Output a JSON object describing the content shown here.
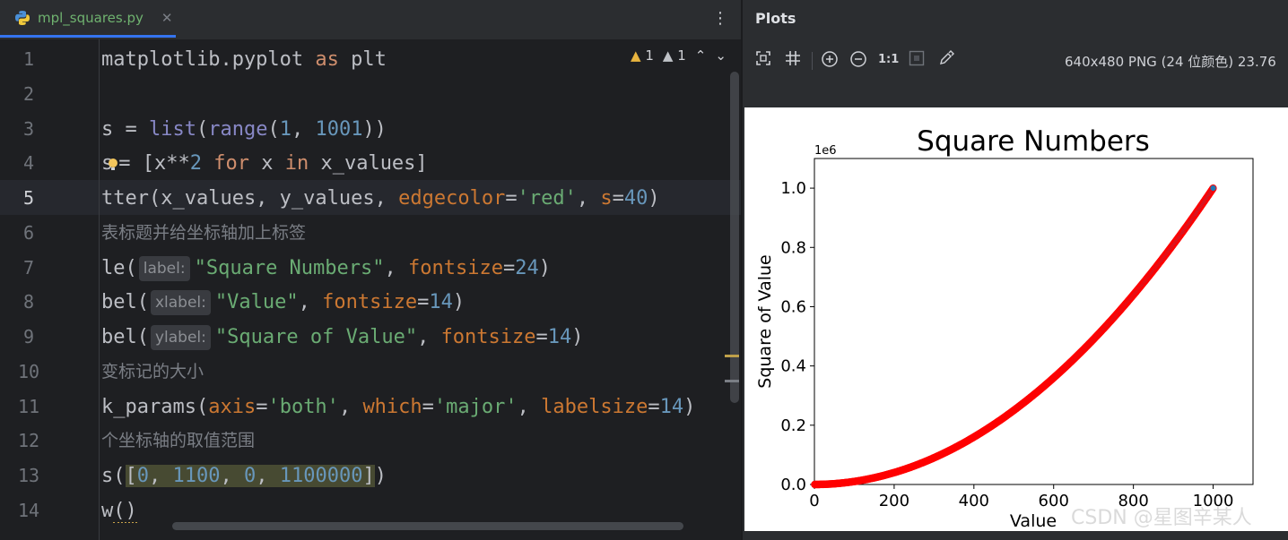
{
  "editor": {
    "tab": {
      "label": "mpl_squares.py",
      "icon": "python-icon",
      "close": "✕"
    },
    "more": "⋮",
    "inspections": {
      "warnings": "1",
      "weak_warnings": "1"
    },
    "current_line": 5,
    "line_numbers": [
      "1",
      "2",
      "3",
      "4",
      "5",
      "6",
      "7",
      "8",
      "9",
      "10",
      "11",
      "12",
      "13",
      "14"
    ],
    "lines": [
      "matplotlib.pyplot as plt",
      "",
      "s = list(range(1, 1001))",
      "s = [x**2 for x in x_values]",
      "tter(x_values, y_values, edgecolor='red', s=40)",
      "表标题并给坐标轴加上标签",
      "le(label: \"Square Numbers\", fontsize=24)",
      "bel(xlabel: \"Value\", fontsize=14)",
      "bel(ylabel: \"Square of Value\", fontsize=14)",
      "变标记的大小",
      "k_params(axis='both', which='major', labelsize=14)",
      "个坐标轴的取值范围",
      "s([0, 1100, 0, 1100000])",
      "w()"
    ],
    "tokens": {
      "l1_a": "matplotlib.pyplot ",
      "l1_as": "as",
      "l1_b": " plt",
      "l3_a": "s = ",
      "l3_list": "list",
      "l3_p": "(",
      "l3_range": "range",
      "l3_p2": "(",
      "l3_1": "1",
      "l3_c": ", ",
      "l3_1001": "1001",
      "l3_e": "))",
      "l4_s": "s",
      "l4_b": "= [x**",
      "l4_2": "2",
      "l4_for": " for",
      "l4_x": " x ",
      "l4_in": "in",
      "l4_c": " x_values]",
      "l5_a": "tter(x_values, y_values, ",
      "l5_ec": "edgecolor",
      "l5_eq": "=",
      "l5_red": "'red'",
      "l5_c": ", ",
      "l5_s": "s",
      "l5_eq2": "=",
      "l5_40": "40",
      "l5_e": ")",
      "l6": "表标题并给坐标轴加上标签",
      "l7_a": "le(",
      "l7_hint": "label:",
      "l7_str": "\"Square Numbers\"",
      "l7_c": ", ",
      "l7_fs": "fontsize",
      "l7_eq": "=",
      "l7_24": "24",
      "l7_e": ")",
      "l8_a": "bel(",
      "l8_hint": "xlabel:",
      "l8_str": "\"Value\"",
      "l8_c": ", ",
      "l8_fs": "fontsize",
      "l8_eq": "=",
      "l8_14": "14",
      "l8_e": ")",
      "l9_a": "bel(",
      "l9_hint": "ylabel:",
      "l9_str": "\"Square of Value\"",
      "l9_c": ", ",
      "l9_fs": "fontsize",
      "l9_eq": "=",
      "l9_14": "14",
      "l9_e": ")",
      "l10": "变标记的大小",
      "l11_a": "k_params(",
      "l11_axis": "axis",
      "l11_eq": "=",
      "l11_both": "'both'",
      "l11_c": ", ",
      "l11_which": "which",
      "l11_eq2": "=",
      "l11_major": "'major'",
      "l11_c2": ", ",
      "l11_ls": "labelsize",
      "l11_eq3": "=",
      "l11_14": "14",
      "l11_e": ")",
      "l12": "个坐标轴的取值范围",
      "l13_a": "s(",
      "l13_b1": "[",
      "l13_0": "0",
      "l13_c1": ", ",
      "l13_1100": "1100",
      "l13_c2": ", ",
      "l13_0b": "0",
      "l13_c3": ", ",
      "l13_1100000": "1100000",
      "l13_b2": "]",
      "l13_e": ")",
      "l14_a": "w",
      "l14_b": "()"
    }
  },
  "plots_panel": {
    "title": "Plots",
    "toolbar": [
      "fit-icon",
      "grid-icon",
      "zoom-in-icon",
      "zoom-out-icon",
      "actual-size-icon",
      "background-icon",
      "color-picker-icon"
    ],
    "actual_size_label": "1:1",
    "image_info": "640x480 PNG (24 位颜色) 23.76"
  },
  "watermark": "CSDN @星图辛某人",
  "chart_data": {
    "type": "scatter",
    "title": "Square Numbers",
    "xlabel": "Value",
    "ylabel": "Square of Value",
    "xlim": [
      0,
      1100
    ],
    "ylim": [
      0,
      1100000
    ],
    "y_offset_label": "1e6",
    "x_ticks": [
      0,
      200,
      400,
      600,
      800,
      1000
    ],
    "x_tick_labels": [
      "0",
      "200",
      "400",
      "600",
      "800",
      "1000"
    ],
    "y_ticks": [
      0,
      200000,
      400000,
      600000,
      800000,
      1000000
    ],
    "y_tick_labels": [
      "0.0",
      "0.2",
      "0.4",
      "0.6",
      "0.8",
      "1.0"
    ],
    "series": [
      {
        "x_range": [
          1,
          1000
        ],
        "function": "y = x**2",
        "edgecolor": "#ff0000",
        "facecolor": "#1f77b4"
      }
    ]
  }
}
